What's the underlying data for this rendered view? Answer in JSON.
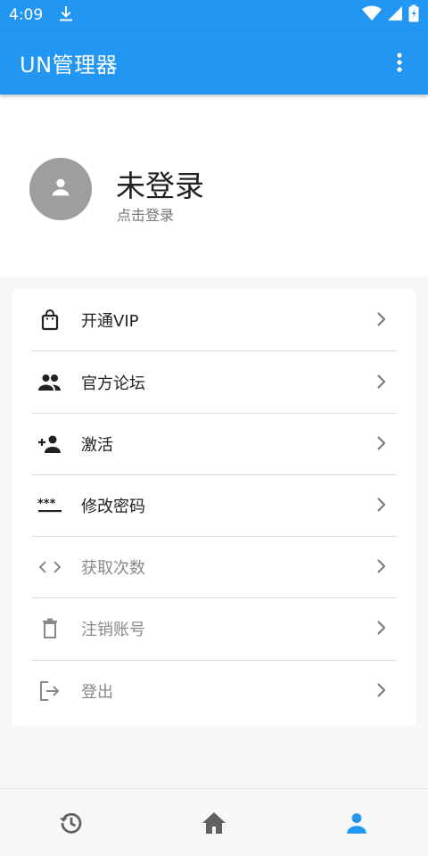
{
  "status_bar": {
    "time": "4:09",
    "icons": [
      "download-icon",
      "wifi-icon",
      "signal-icon",
      "battery-icon"
    ]
  },
  "app_bar": {
    "title": "UN管理器",
    "menu_icon": "more-vert-icon"
  },
  "profile": {
    "avatar_icon": "person-icon",
    "name": "未登录",
    "subtitle": "点击登录"
  },
  "menu": {
    "items": [
      {
        "label": "开通VIP",
        "icon": "shopping-bag-icon",
        "enabled": true
      },
      {
        "label": "官方论坛",
        "icon": "group-icon",
        "enabled": true
      },
      {
        "label": "激活",
        "icon": "person-add-icon",
        "enabled": true
      },
      {
        "label": "修改密码",
        "icon": "password-icon",
        "enabled": true
      },
      {
        "label": "获取次数",
        "icon": "code-icon",
        "enabled": false
      },
      {
        "label": "注销账号",
        "icon": "delete-icon",
        "enabled": false
      },
      {
        "label": "登出",
        "icon": "logout-icon",
        "enabled": false
      }
    ]
  },
  "bottom_nav": {
    "items": [
      {
        "icon": "history-icon",
        "active": false
      },
      {
        "icon": "home-icon",
        "active": false
      },
      {
        "icon": "person-icon",
        "active": true
      }
    ]
  },
  "colors": {
    "primary": "#2196f3",
    "text_primary": "#212121",
    "text_disabled": "#8a8a8a",
    "icon_inactive": "#616161",
    "avatar_bg": "#9e9e9e"
  }
}
